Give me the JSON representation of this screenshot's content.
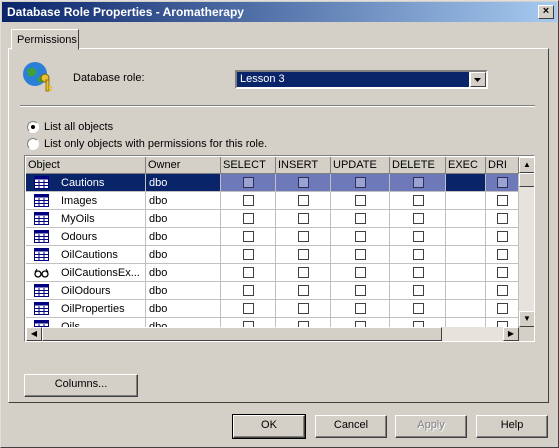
{
  "window": {
    "title": "Database Role Properties - Aromatherapy"
  },
  "tabs": [
    {
      "label": "Permissions"
    }
  ],
  "role": {
    "label": "Database role:",
    "value": "Lesson 3"
  },
  "options": {
    "list_all": "List all objects",
    "list_only": "List only objects with permissions for this role."
  },
  "grid": {
    "columns": [
      "Object",
      "Owner",
      "SELECT",
      "INSERT",
      "UPDATE",
      "DELETE",
      "EXEC",
      "DRI"
    ],
    "rows": [
      {
        "name": "Cautions",
        "owner": "dbo",
        "icon": "table-icon",
        "selected": true
      },
      {
        "name": "Images",
        "owner": "dbo",
        "icon": "table-icon"
      },
      {
        "name": "MyOils",
        "owner": "dbo",
        "icon": "table-icon"
      },
      {
        "name": "Odours",
        "owner": "dbo",
        "icon": "table-icon"
      },
      {
        "name": "OilCautions",
        "owner": "dbo",
        "icon": "table-icon"
      },
      {
        "name": "OilCautionsEx...",
        "owner": "dbo",
        "icon": "view-icon"
      },
      {
        "name": "OilOdours",
        "owner": "dbo",
        "icon": "table-icon"
      },
      {
        "name": "OilProperties",
        "owner": "dbo",
        "icon": "table-icon"
      },
      {
        "name": "Oils",
        "owner": "dbo",
        "icon": "table-icon"
      }
    ]
  },
  "buttons": {
    "columns": "Columns...",
    "ok": "OK",
    "cancel": "Cancel",
    "apply": "Apply",
    "help": "Help"
  },
  "colors": {
    "titlebar": "#0a246a",
    "selection": "#0a246a",
    "face": "#d4d0c8"
  }
}
